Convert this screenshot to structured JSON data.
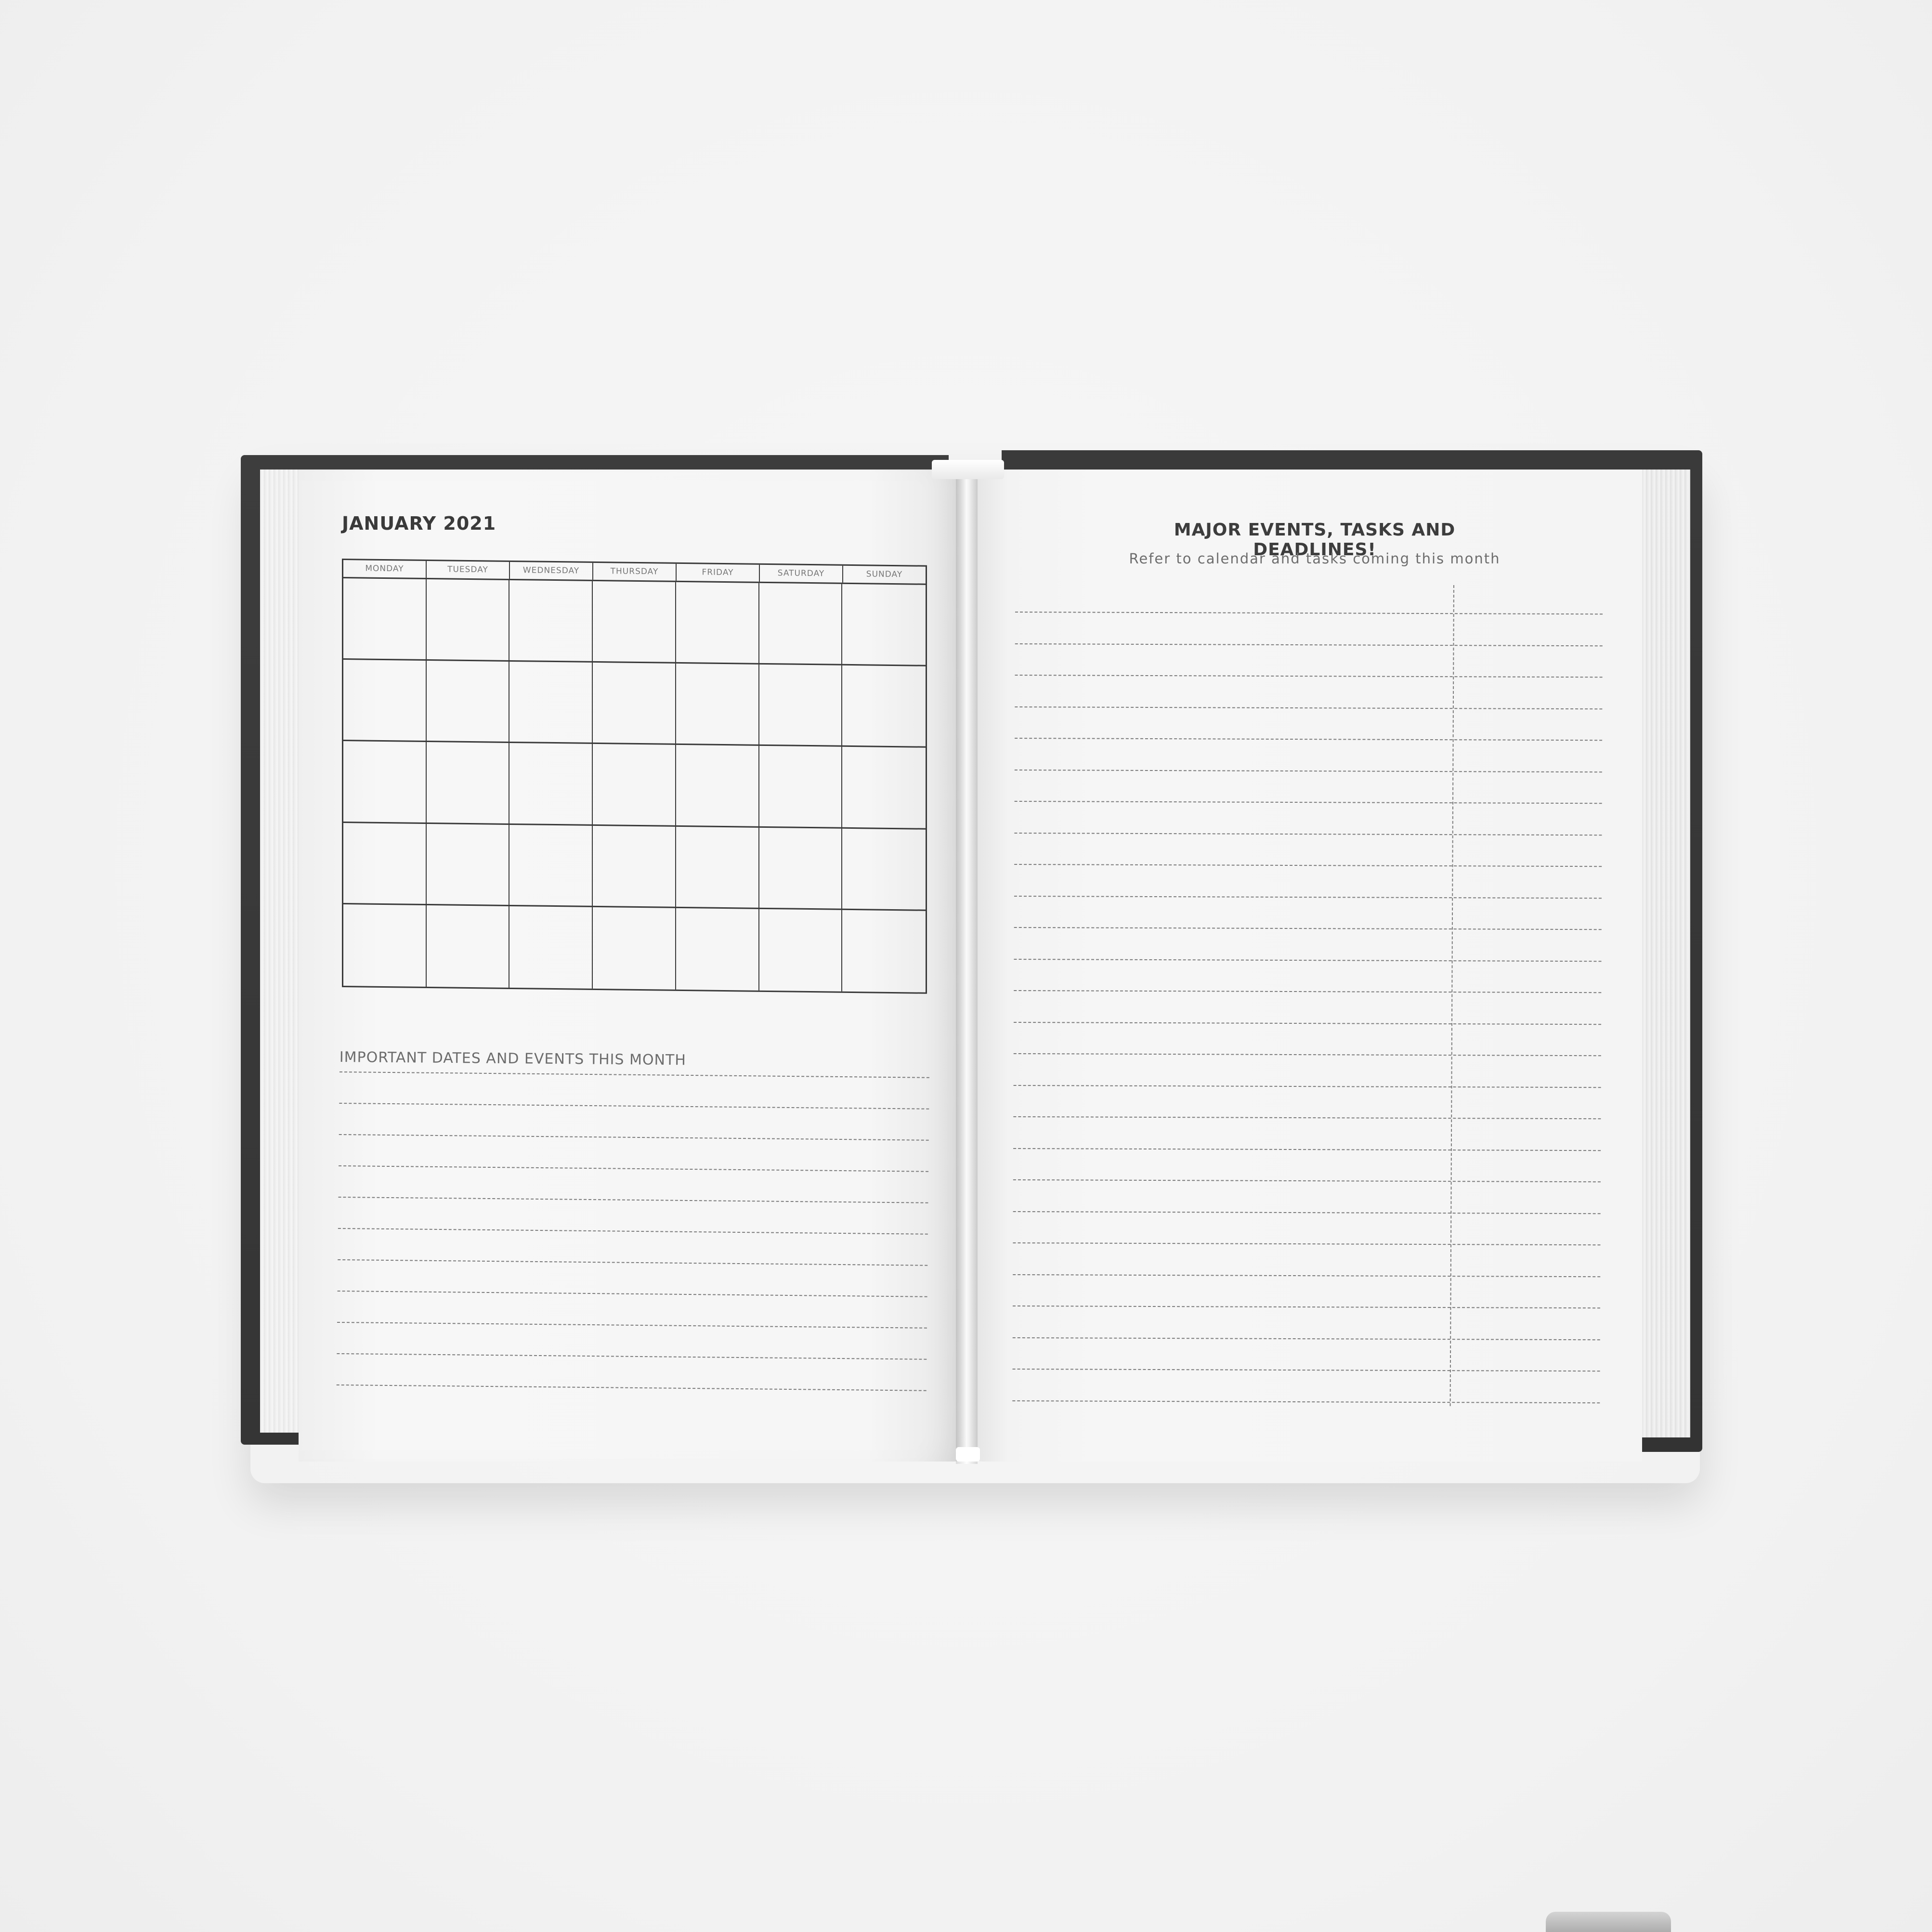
{
  "left_page": {
    "month_title": "JANUARY 2021",
    "weekdays": [
      "MONDAY",
      "TUESDAY",
      "WEDNESDAY",
      "THURSDAY",
      "FRIDAY",
      "SATURDAY",
      "SUNDAY"
    ],
    "calendar_rows": 5,
    "important_label": "IMPORTANT DATES AND EVENTS THIS MONTH",
    "line_count": 11
  },
  "right_page": {
    "title": "MAJOR EVENTS, TASKS AND DEADLINES!",
    "subtitle": "Refer to calendar and tasks coming this month",
    "line_count": 26
  },
  "colors": {
    "cover": "#383838",
    "page": "#f6f6f6",
    "ink": "#3a3a3a",
    "background": "#f4f4f4"
  }
}
